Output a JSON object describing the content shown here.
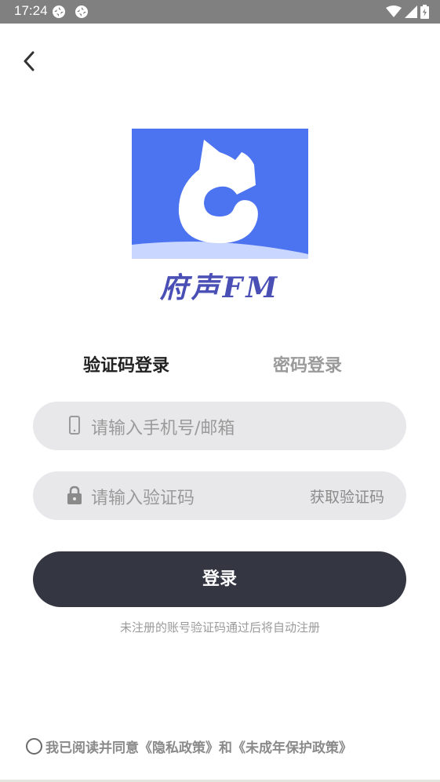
{
  "status_bar": {
    "time": "17:24"
  },
  "logo": {
    "brand_text": "府声FM"
  },
  "tabs": {
    "sms_login": "验证码登录",
    "password_login": "密码登录"
  },
  "phone_field": {
    "placeholder": "请输入手机号/邮箱",
    "icon": "phone-icon"
  },
  "code_field": {
    "placeholder": "请输入验证码",
    "icon": "lock-icon",
    "get_code_label": "获取验证码"
  },
  "login_button": {
    "label": "登录"
  },
  "hint": "未注册的账号验证码通过后将自动注册",
  "agreement": {
    "text": "我已阅读并同意《隐私政策》和《未成年保护政策》",
    "checked": false
  },
  "colors": {
    "brand_blue": "#4d74f0",
    "button_dark": "#343642",
    "field_bg": "#e8e8ea",
    "status_bar": "#808080"
  }
}
